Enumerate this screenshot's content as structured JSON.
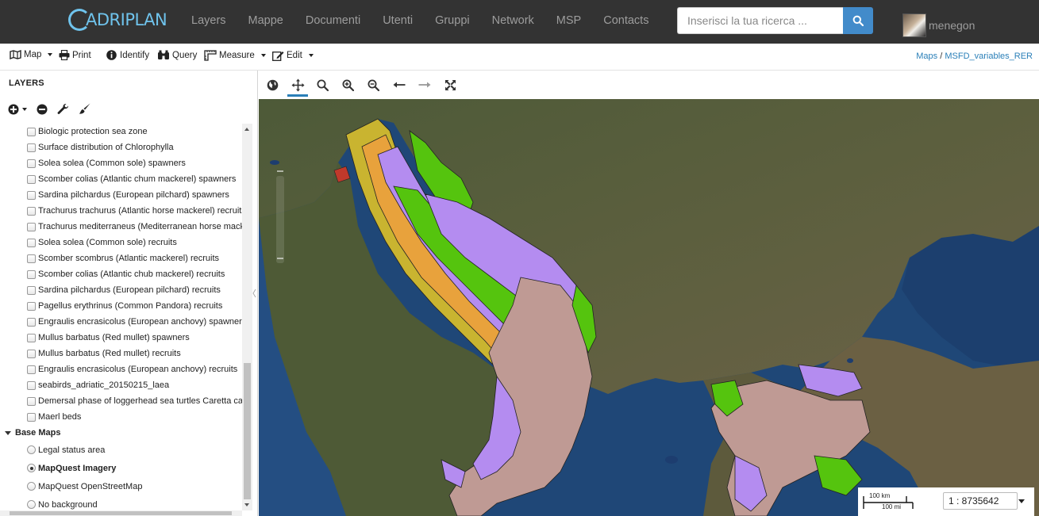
{
  "brand": {
    "name": "ADRIPLAN"
  },
  "nav": [
    "Layers",
    "Mappe",
    "Documenti",
    "Utenti",
    "Gruppi",
    "Network",
    "MSP",
    "Contacts"
  ],
  "search": {
    "placeholder": "Inserisci la tua ricerca ..."
  },
  "user": {
    "name": "menegon"
  },
  "toolbar": {
    "map_label": "Map",
    "print_label": "Print",
    "identify_label": "Identify",
    "query_label": "Query",
    "measure_label": "Measure",
    "edit_label": "Edit"
  },
  "breadcrumb": {
    "root": "Maps",
    "separator": "/",
    "current": "MSFD_variables_RER"
  },
  "sidebar": {
    "title": "LAYERS",
    "layers": [
      "Biologic protection sea zone",
      "Surface distribution of Chlorophylla",
      "Solea solea (Common sole) spawners",
      "Scomber colias (Atlantic chum mackerel) spawners",
      "Sardina pilchardus (European pilchard) spawners",
      "Trachurus trachurus (Atlantic horse mackerel) recruits",
      "Trachurus mediterraneus (Mediterranean horse mackerel) recruits",
      "Solea solea (Common sole) recruits",
      "Scomber scombrus (Atlantic mackerel) recruits",
      "Scomber colias (Atlantic chub mackerel) recruits",
      "Sardina pilchardus (European pilchard) recruits",
      "Pagellus erythrinus (Common Pandora) recruits",
      "Engraulis encrasicolus (European anchovy) spawners",
      "Mullus barbatus (Red mullet) spawners",
      "Mullus barbatus (Red mullet) recruits",
      "Engraulis encrasicolus (European anchovy) recruits",
      "seabirds_adriatic_20150215_laea",
      "Demersal phase of loggerhead sea turtles Caretta caretta",
      "Maerl beds"
    ],
    "base_group": "Base Maps",
    "base_maps": [
      {
        "label": "Legal status area",
        "selected": false
      },
      {
        "label": "MapQuest Imagery",
        "selected": true
      },
      {
        "label": "MapQuest OpenStreetMap",
        "selected": false
      },
      {
        "label": "No background",
        "selected": false
      }
    ]
  },
  "scale": {
    "km_label": "100 km",
    "mi_label": "100 mi",
    "ratio": "1 : 8735642"
  },
  "colors": {
    "navbar_bg": "#333333",
    "brand": "#6fc3ec",
    "search_button": "#428bca",
    "link": "#2a7fb8",
    "map_purple": "#b48cf0",
    "map_green": "#55c40e",
    "map_rose": "#bf9a94",
    "map_yellow": "#c9b430",
    "map_orange": "#e8a23c"
  }
}
